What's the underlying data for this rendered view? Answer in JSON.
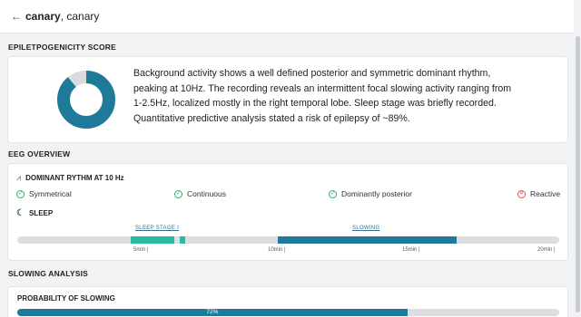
{
  "header": {
    "back_icon": "arrow-left-icon",
    "patient_bold": "canary",
    "patient_rest": ", canary"
  },
  "colors": {
    "primary": "#1f7a99",
    "teal": "#2bb8a5",
    "track": "#dcdee2",
    "check": "#3aa66b",
    "cross": "#d9534f"
  },
  "score_section": {
    "title": "EPILETPOGENICITY SCORE",
    "risk_fraction": 0.89,
    "line1": "Background activity shows a well defined posterior and symmetric dominant rhythm,",
    "line2": "peaking at 10Hz. The recording reveals an intermittent focal slowing activity ranging from",
    "line3": "1-2.5Hz, localized mostly in the right temporal lobe. Sleep stage was briefly recorded.",
    "line4": "Quantitative predictive analysis stated a risk of epilepsy of ~89%."
  },
  "eeg_section": {
    "title": "EEG OVERVIEW",
    "rythm_label": "DOMINANT RYTHM AT 10 Hz",
    "symmetrical": "Symmetrical",
    "continuous": "Continuous",
    "posterior": "Dominantly posterior",
    "reactive": "Reactive",
    "sleep_label": "SLEEP",
    "sleep_stage_label": "SLEEP STAGE I",
    "slowing_label": "SLOWING",
    "timeline_total_min": 20,
    "sleep_segments": [
      [
        4.2,
        5.8
      ],
      [
        6.0,
        6.2
      ]
    ],
    "slowing_segments": [
      [
        9.6,
        16.2
      ]
    ],
    "ticks": [
      "5min |",
      "10min |",
      "15min |",
      "20min |"
    ]
  },
  "slowing_section": {
    "title": "SLOWING ANALYSIS",
    "prob_title": "PROBABILITY OF SLOWING",
    "prob_value": 0.72,
    "prob_text": "72%"
  }
}
